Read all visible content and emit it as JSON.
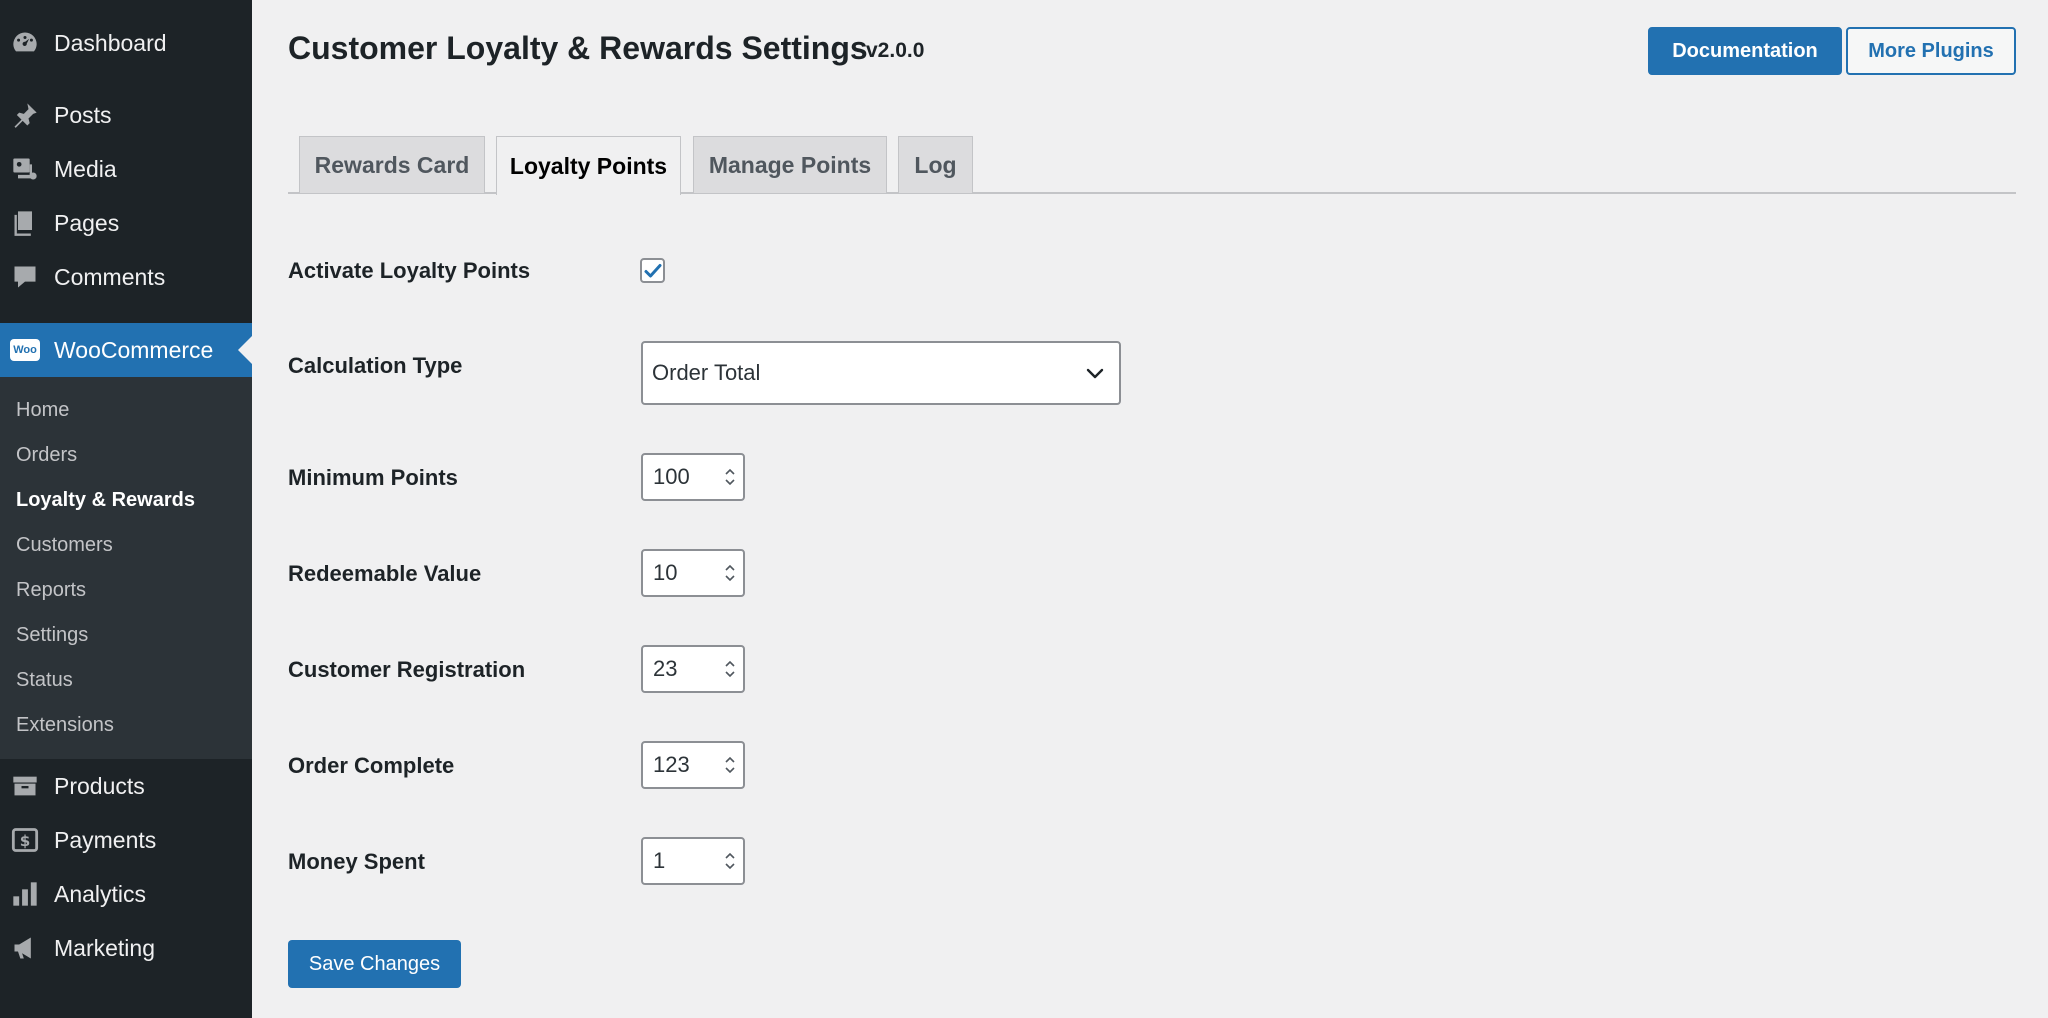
{
  "sidebar": {
    "top_items": [
      {
        "label": "Dashboard",
        "icon": "dashboard-icon"
      },
      {
        "label": "Posts",
        "icon": "pin-icon"
      },
      {
        "label": "Media",
        "icon": "media-icon"
      },
      {
        "label": "Pages",
        "icon": "pages-icon"
      },
      {
        "label": "Comments",
        "icon": "comment-icon"
      }
    ],
    "woocommerce": {
      "label": "WooCommerce",
      "icon": "woo-icon",
      "icon_text": "Woo"
    },
    "submenu": [
      "Home",
      "Orders",
      "Loyalty & Rewards",
      "Customers",
      "Reports",
      "Settings",
      "Status",
      "Extensions"
    ],
    "submenu_active": "Loyalty & Rewards",
    "bottom_items": [
      {
        "label": "Products",
        "icon": "archive-icon"
      },
      {
        "label": "Payments",
        "icon": "dollar-icon"
      },
      {
        "label": "Analytics",
        "icon": "bar-chart-icon"
      },
      {
        "label": "Marketing",
        "icon": "megaphone-icon"
      }
    ]
  },
  "header": {
    "title": "Customer Loyalty & Rewards Settings",
    "version": "v2.0.0",
    "documentation_label": "Documentation",
    "more_plugins_label": "More Plugins"
  },
  "tabs": [
    {
      "label": "Rewards Card",
      "active": false
    },
    {
      "label": "Loyalty Points",
      "active": true
    },
    {
      "label": "Manage Points",
      "active": false
    },
    {
      "label": "Log",
      "active": false
    }
  ],
  "form": {
    "activate": {
      "label": "Activate Loyalty Points",
      "checked": true
    },
    "calculation_type": {
      "label": "Calculation Type",
      "value": "Order Total"
    },
    "minimum_points": {
      "label": "Minimum Points",
      "value": "100"
    },
    "redeemable_value": {
      "label": "Redeemable Value",
      "value": "10"
    },
    "customer_registration": {
      "label": "Customer Registration",
      "value": "23"
    },
    "order_complete": {
      "label": "Order Complete",
      "value": "123"
    },
    "money_spent": {
      "label": "Money Spent",
      "value": "1"
    },
    "save_label": "Save Changes"
  },
  "colors": {
    "sidebar_bg": "#1d2327",
    "submenu_bg": "#2c3338",
    "accent": "#2271b1",
    "page_bg": "#f0f0f1"
  }
}
